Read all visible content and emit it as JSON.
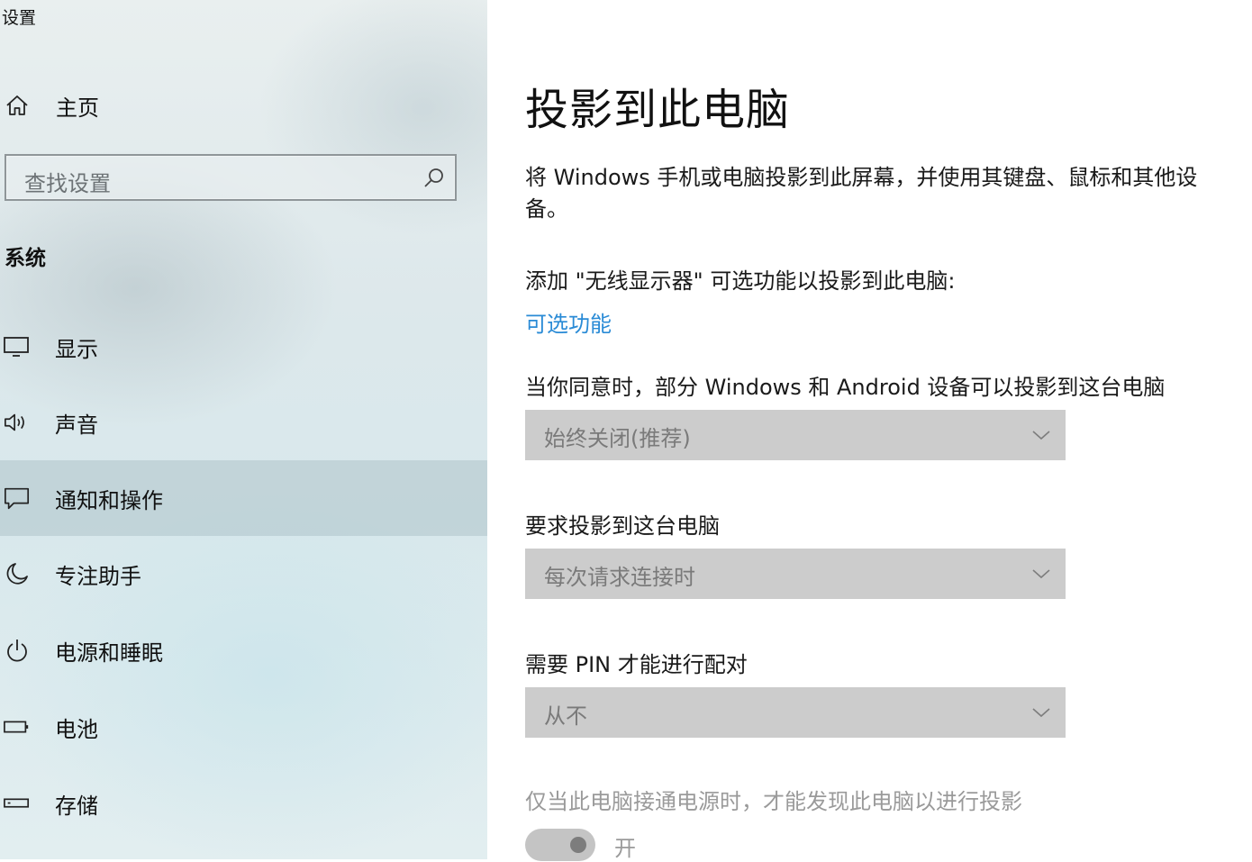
{
  "app": {
    "title": "设置"
  },
  "sidebar": {
    "home_label": "主页",
    "search": {
      "placeholder": "查找设置"
    },
    "section": "系统",
    "items": [
      {
        "label": "显示",
        "icon": "monitor-icon"
      },
      {
        "label": "声音",
        "icon": "speaker-icon"
      },
      {
        "label": "通知和操作",
        "icon": "notification-icon",
        "selected": true
      },
      {
        "label": "专注助手",
        "icon": "moon-icon"
      },
      {
        "label": "电源和睡眠",
        "icon": "power-icon"
      },
      {
        "label": "电池",
        "icon": "battery-icon"
      },
      {
        "label": "存储",
        "icon": "storage-icon"
      }
    ]
  },
  "main": {
    "title": "投影到此电脑",
    "description": "将 Windows 手机或电脑投影到此屏幕，并使用其键盘、鼠标和其他设备。",
    "prompt": "添加 \"无线显示器\" 可选功能以投影到此电脑:",
    "link": "可选功能",
    "settings": [
      {
        "label": "当你同意时，部分 Windows 和 Android 设备可以投影到这台电脑",
        "value": "始终关闭(推荐)"
      },
      {
        "label": "要求投影到这台电脑",
        "value": "每次请求连接时"
      },
      {
        "label": "需要 PIN 才能进行配对",
        "value": "从不"
      }
    ],
    "power_setting": {
      "label": "仅当此电脑接通电源时，才能发现此电脑以进行投影",
      "toggle_state": "开",
      "enabled": false
    }
  },
  "colors": {
    "link": "#2a8bd6",
    "dropdown_bg": "#cccccc",
    "selected_bg": "#b9cbd1"
  }
}
